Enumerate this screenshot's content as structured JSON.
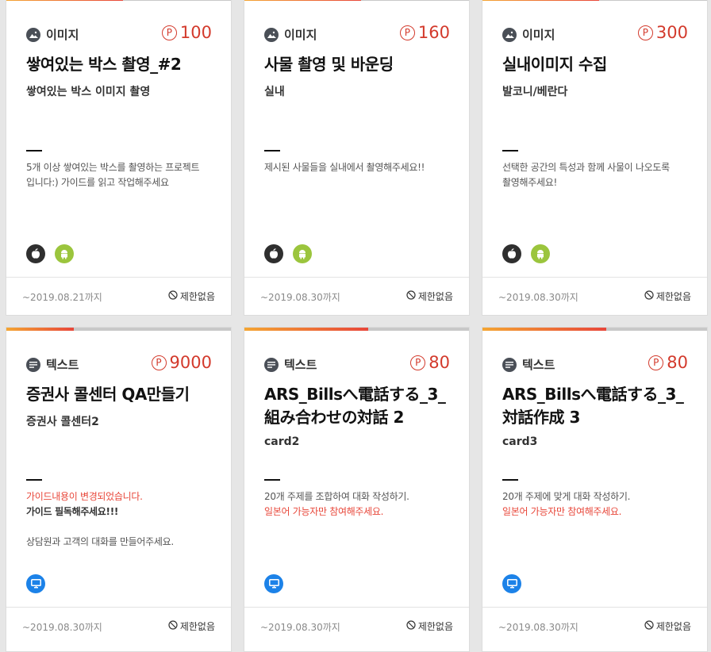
{
  "cards": [
    {
      "type_label": "이미지",
      "price": "100",
      "title": "쌓여있는 박스 촬영_#2",
      "subtitle": "쌓여있는 박스 이미지 촬영",
      "desc_lines": [
        "5개 이상 쌓여있는 박스를 촬영하는 프로젝트",
        "입니다:) 가이드를 읽고 작업해주세요"
      ],
      "platforms": [
        "apple-icon",
        "android-icon"
      ],
      "deadline": "~2019.08.21까지",
      "limit": "제한없음",
      "progress": 0.52
    },
    {
      "type_label": "이미지",
      "price": "160",
      "title": "사물 촬영 및 바운딩",
      "subtitle": "실내",
      "desc_lines": [
        "제시된 사물들을 실내에서 촬영해주세요!!"
      ],
      "platforms": [
        "apple-icon",
        "android-icon"
      ],
      "deadline": "~2019.08.30까지",
      "limit": "제한없음",
      "progress": 0.52
    },
    {
      "type_label": "이미지",
      "price": "300",
      "title": "실내이미지 수집",
      "subtitle": "발코니/베란다",
      "desc_lines": [
        "선택한 공간의 특성과 함께 사물이 나오도록",
        "촬영해주세요!"
      ],
      "platforms": [
        "apple-icon",
        "android-icon"
      ],
      "deadline": "~2019.08.30까지",
      "limit": "제한없음",
      "progress": 0.52
    },
    {
      "type_label": "텍스트",
      "price": "9000",
      "title": "증권사 콜센터 QA만들기",
      "subtitle": "증권사 콜센터2",
      "desc_red": "가이드내용이 변경되었습니다.",
      "desc_bold": "가이드 필독해주세요!!!",
      "desc_tail": "상담원과 고객의 대화를 만들어주세요.",
      "platforms": [
        "monitor-icon"
      ],
      "deadline": "~2019.08.30까지",
      "limit": "제한없음",
      "progress": 0.3
    },
    {
      "type_label": "텍스트",
      "price": "80",
      "title_lines": [
        "ARS_Billsへ電話する_3_",
        "組み合わせの対話 2"
      ],
      "subtitle": "card2",
      "desc_line": "20개 주제를 조합하여 대화 작성하기.",
      "desc_red": "일본어 가능자만 참여해주세요.",
      "platforms": [
        "monitor-icon"
      ],
      "deadline": "~2019.08.30까지",
      "limit": "제한없음",
      "progress": 0.55
    },
    {
      "type_label": "텍스트",
      "price": "80",
      "title_lines": [
        "ARS_Billsへ電話する_3_",
        "対話作成 3"
      ],
      "subtitle": "card3",
      "desc_line": "20개 주제에 맞게 대화 작성하기.",
      "desc_red": "일본어 가능자만 참여해주세요.",
      "platforms": [
        "monitor-icon"
      ],
      "deadline": "~2019.08.30까지",
      "limit": "제한없음",
      "progress": 0.55
    }
  ]
}
